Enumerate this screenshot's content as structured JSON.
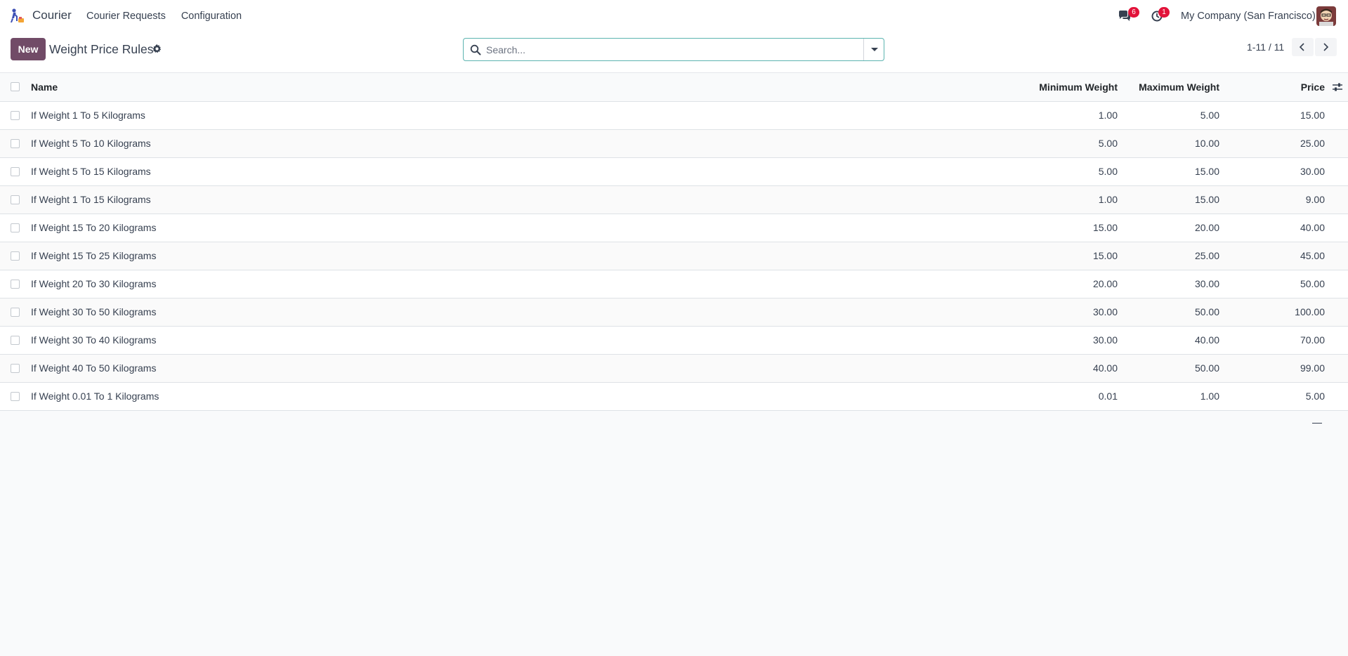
{
  "navbar": {
    "app_name": "Courier",
    "menu": [
      {
        "label": "Courier Requests"
      },
      {
        "label": "Configuration"
      }
    ],
    "chat_badge": "6",
    "activity_badge": "1",
    "company": "My Company (San Francisco)"
  },
  "control_panel": {
    "new_label": "New",
    "title": "Weight Price Rules",
    "search_placeholder": "Search...",
    "pager": "1-11 / 11"
  },
  "table": {
    "columns": {
      "name": "Name",
      "min_weight": "Minimum Weight",
      "max_weight": "Maximum Weight",
      "price": "Price"
    },
    "rows": [
      {
        "name": "If Weight 1 To 5 Kilograms",
        "min": "1.00",
        "max": "5.00",
        "price": "15.00"
      },
      {
        "name": "If Weight 5 To 10 Kilograms",
        "min": "5.00",
        "max": "10.00",
        "price": "25.00"
      },
      {
        "name": "If Weight 5 To 15 Kilograms",
        "min": "5.00",
        "max": "15.00",
        "price": "30.00"
      },
      {
        "name": "If Weight 1 To 15 Kilograms",
        "min": "1.00",
        "max": "15.00",
        "price": "9.00"
      },
      {
        "name": "If Weight 15 To 20 Kilograms",
        "min": "15.00",
        "max": "20.00",
        "price": "40.00"
      },
      {
        "name": "If Weight 15 To 25 Kilograms",
        "min": "15.00",
        "max": "25.00",
        "price": "45.00"
      },
      {
        "name": "If Weight 20 To 30 Kilograms",
        "min": "20.00",
        "max": "30.00",
        "price": "50.00"
      },
      {
        "name": "If Weight 30 To 50 Kilograms",
        "min": "30.00",
        "max": "50.00",
        "price": "100.00"
      },
      {
        "name": "If Weight 30 To 40 Kilograms",
        "min": "30.00",
        "max": "40.00",
        "price": "70.00"
      },
      {
        "name": "If Weight 40 To 50 Kilograms",
        "min": "40.00",
        "max": "50.00",
        "price": "99.00"
      },
      {
        "name": "If Weight 0.01 To 1 Kilograms",
        "min": "0.01",
        "max": "1.00",
        "price": "5.00"
      }
    ]
  },
  "icons": {
    "app_logo": "courier-logo-icon",
    "chat": "chat-icon",
    "activity": "clock-icon",
    "gear": "gear-icon",
    "search": "search-icon",
    "optional_columns": "sliders-icon"
  },
  "colors": {
    "primary": "#714b67",
    "badge": "#e2133a",
    "search_border": "#5cb4b0"
  }
}
